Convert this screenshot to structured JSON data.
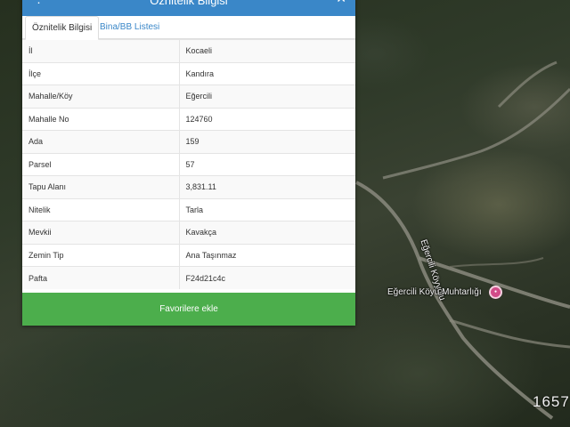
{
  "panel": {
    "title": "Öznitelik Bilgisi",
    "tabs": [
      {
        "label": "Öznitelik Bilgisi",
        "active": true
      },
      {
        "label": "Bina/BB Listesi",
        "active": false
      }
    ],
    "rows": [
      {
        "key": "İl",
        "value": "Kocaeli"
      },
      {
        "key": "İlçe",
        "value": "Kandıra"
      },
      {
        "key": "Mahalle/Köy",
        "value": "Eğercili"
      },
      {
        "key": "Mahalle No",
        "value": "124760"
      },
      {
        "key": "Ada",
        "value": "159"
      },
      {
        "key": "Parsel",
        "value": "57"
      },
      {
        "key": "Tapu Alanı",
        "value": "3,831.11"
      },
      {
        "key": "Nitelik",
        "value": "Tarla"
      },
      {
        "key": "Mevkii",
        "value": "Kavakça"
      },
      {
        "key": "Zemin Tip",
        "value": "Ana Taşınmaz"
      },
      {
        "key": "Pafta",
        "value": "F24d21c4c"
      }
    ],
    "favorite_button": "Favorilere ekle",
    "colors": {
      "header": "#3a87c8",
      "button": "#4cae4c"
    }
  },
  "map": {
    "road_label": "Eğercili Köyyolu",
    "poi_label": "Eğercili Köyü Muhtarlığı",
    "scale_text": "1657"
  }
}
